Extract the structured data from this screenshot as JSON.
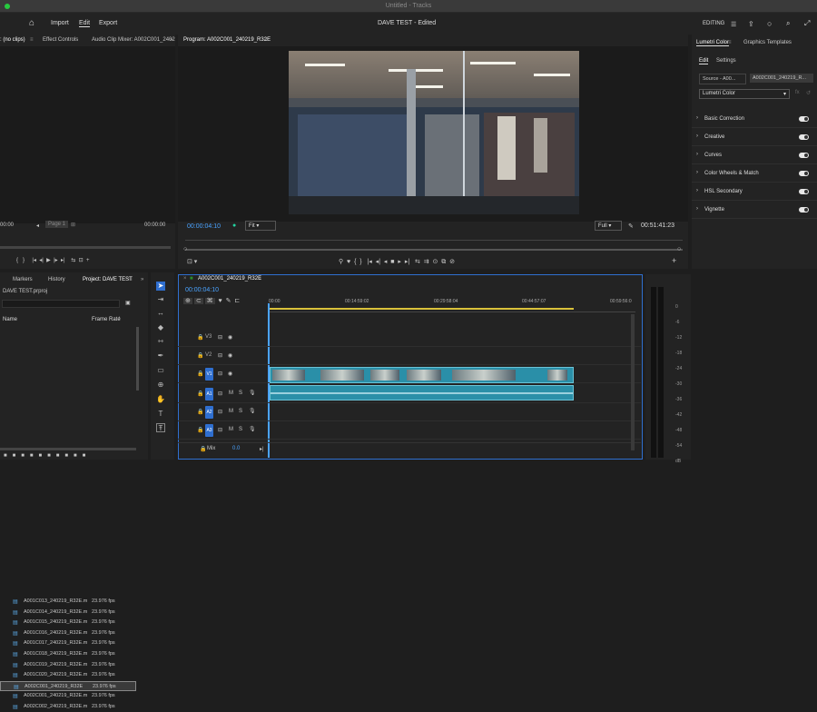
{
  "titlebar": {
    "title": "Untitled - Tracks"
  },
  "header": {
    "home": "⌂",
    "import": "Import",
    "edit": "Edit",
    "export": "Export",
    "project_title": "DAVE TEST - Edited",
    "editing": "EDITING"
  },
  "source_panel": {
    "tab_source": ": (no clips)",
    "tab_effects": "Effect Controls",
    "tab_mixer": "Audio Clip Mixer: A002C001_2402",
    "tc_left": "00:00",
    "page": "Page 1",
    "tc_right": "00:00:00"
  },
  "program": {
    "title": "Program: A002C001_240219_R32E",
    "timecode": "00:00:04:10",
    "fit": "Fit",
    "quality": "Full",
    "duration": "00:51:41:23"
  },
  "lumetri": {
    "tab_color": "Lumetri Color",
    "tab_templates": "Graphics Templates",
    "sub_edit": "Edit",
    "sub_settings": "Settings",
    "source": "Source - A00...",
    "clip": "A002C001_240219_R...",
    "effect": "Lumetri Color",
    "sections": [
      "Basic Correction",
      "Creative",
      "Curves",
      "Color Wheels & Match",
      "HSL Secondary",
      "Vignette"
    ]
  },
  "project": {
    "tab_markers": "Markers",
    "tab_history": "History",
    "tab_project": "Project: DAVE TEST",
    "file": "DAVE TEST.prproj",
    "col_name": "Name",
    "col_fps": "Frame Rate",
    "items": [
      {
        "name": "A001C013_240219_R32E.m",
        "fps": "23.976 fps"
      },
      {
        "name": "A001C014_240219_R32E.m",
        "fps": "23.976 fps"
      },
      {
        "name": "A001C015_240219_R32E.m",
        "fps": "23.976 fps"
      },
      {
        "name": "A001C016_240219_R32E.m",
        "fps": "23.976 fps"
      },
      {
        "name": "A001C017_240219_R32E.m",
        "fps": "23.976 fps"
      },
      {
        "name": "A001C018_240219_R32E.m",
        "fps": "23.976 fps"
      },
      {
        "name": "A001C019_240219_R32E.m",
        "fps": "23.976 fps"
      },
      {
        "name": "A001C020_240219_R32E.m",
        "fps": "23.976 fps"
      },
      {
        "name": "A002C001_240219_R32E",
        "fps": "23.976 fps"
      },
      {
        "name": "A002C001_240219_R32E.m",
        "fps": "23.976 fps"
      },
      {
        "name": "A002C002_240219_R32E.m",
        "fps": "23.976 fps"
      }
    ]
  },
  "timeline": {
    "tab": "A002C001_240219_R32E",
    "timecode": "00:00:04:10",
    "ruler": [
      "00:00",
      "00:14:59:02",
      "00:29:58:04",
      "00:44:57:07",
      "00:59:56:0"
    ],
    "tracks": [
      "V3",
      "V2",
      "V1",
      "A1",
      "A2",
      "A3"
    ],
    "mix": "Mix",
    "mix_val": "0.0"
  },
  "meter": {
    "ticks": [
      "0",
      "-6",
      "-12",
      "-18",
      "-24",
      "-30",
      "-36",
      "-42",
      "-48",
      "-54",
      "dB"
    ]
  },
  "colors": {
    "accent": "#2f6fd0",
    "clip_video": "#2a8fa8",
    "timecode": "#4aa3ff",
    "work_area": "#d9c13a"
  }
}
